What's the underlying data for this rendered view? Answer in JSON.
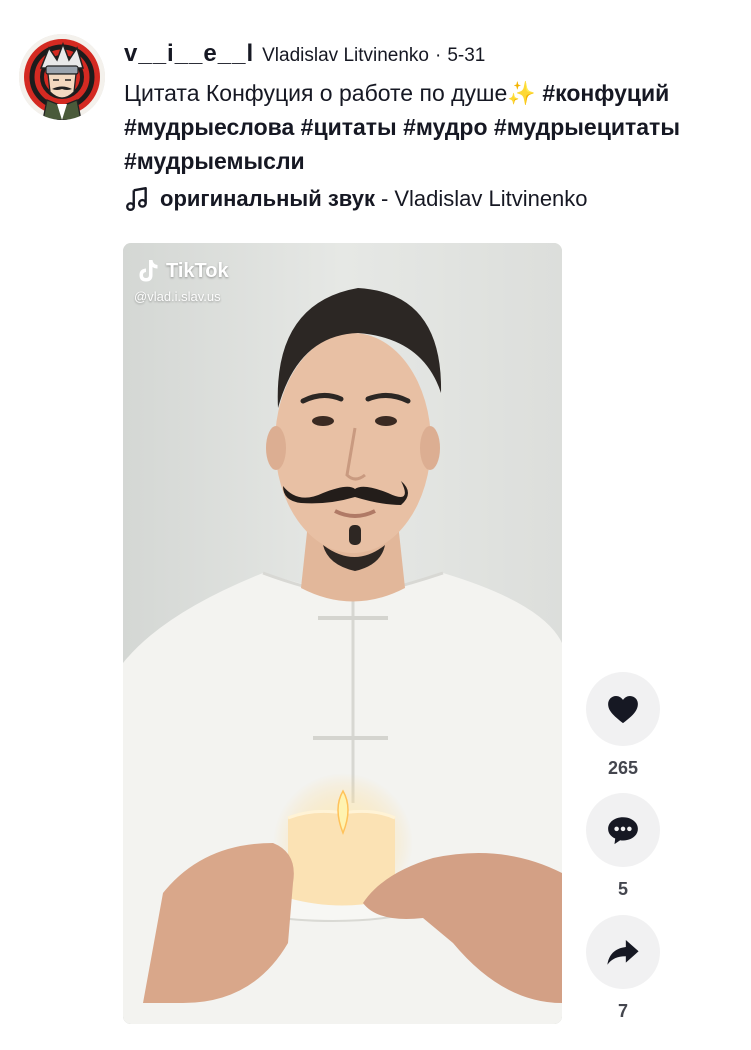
{
  "post": {
    "username": "v__i__e__l",
    "nickname": "Vladislav Litvinenko",
    "separator": "·",
    "date": "5-31",
    "caption_text": "Цитата Конфуция о работе по душе",
    "caption_emoji": "✨",
    "hashtags": [
      "#конфуций",
      "#мудрыеслова",
      "#цитаты",
      "#мудро",
      "#мудрыецитаты",
      "#мудрыемысли"
    ]
  },
  "music": {
    "icon": "music-note-icon",
    "title": "оригинальный звук",
    "dash": "-",
    "artist": "Vladislav Litvinenko"
  },
  "video": {
    "watermark_brand": "TikTok",
    "watermark_handle": "@vlad.i.slav.us"
  },
  "actions": {
    "like": {
      "icon": "heart-icon",
      "count": "265"
    },
    "comment": {
      "icon": "comment-icon",
      "count": "5"
    },
    "share": {
      "icon": "share-icon",
      "count": "7"
    }
  },
  "colors": {
    "text": "#161823",
    "button_bg": "#f1f1f2",
    "avatar_accent": "#d42a22"
  }
}
